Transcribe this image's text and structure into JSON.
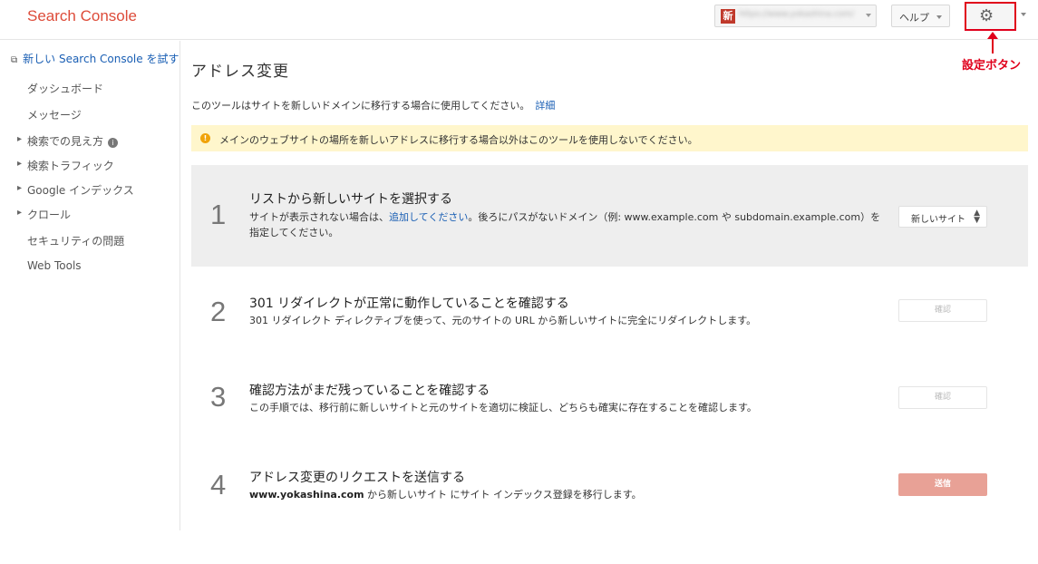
{
  "header": {
    "brand": "Search Console",
    "site_badge": "新",
    "site_url": "https://www.yokashina.com/",
    "help_label": "ヘルプ",
    "settings_icon": "gear-icon",
    "annotation": "設定ボタン",
    "accent": "#e0001b"
  },
  "sidebar": {
    "try_new": "新しい Search Console を試す",
    "items": [
      {
        "label": "ダッシュボード",
        "expandable": false
      },
      {
        "label": "メッセージ",
        "expandable": false
      },
      {
        "label": "検索での見え方",
        "expandable": true,
        "info": "i"
      },
      {
        "label": "検索トラフィック",
        "expandable": true
      },
      {
        "label": "Google インデックス",
        "expandable": true
      },
      {
        "label": "クロール",
        "expandable": true
      },
      {
        "label": "セキュリティの問題",
        "expandable": false
      },
      {
        "label": "Web Tools",
        "expandable": false
      }
    ]
  },
  "main": {
    "title": "アドレス変更",
    "intro": "このツールはサイトを新しいドメインに移行する場合に使用してください。",
    "intro_link": "詳細",
    "warning": "メインのウェブサイトの場所を新しいアドレスに移行する場合以外はこのツールを使用しないでください。",
    "steps": [
      {
        "number": "1",
        "title": "リストから新しいサイトを選択する",
        "desc_a": "サイトが表示されない場合は、",
        "desc_link": "追加してください",
        "desc_b": "。後ろにパスがないドメイン（例: www.example.com や subdomain.example.com）を",
        "desc_c": "指定してください。",
        "select_label": "新しいサイト"
      },
      {
        "number": "2",
        "title": "301 リダイレクトが正常に動作していることを確認する",
        "desc": "301 リダイレクト ディレクティブを使って、元のサイトの URL から新しいサイトに完全にリダイレクトします。",
        "button": "確認"
      },
      {
        "number": "3",
        "title": "確認方法がまだ残っていることを確認する",
        "desc": "この手順では、移行前に新しいサイトと元のサイトを適切に検証し、どちらも確実に存在することを確認します。",
        "button": "確認"
      },
      {
        "number": "4",
        "title": "アドレス変更のリクエストを送信する",
        "desc_bold": "www.yokashina.com",
        "desc": " から新しいサイト にサイト インデックス登録を移行します。",
        "button": "送信"
      }
    ]
  }
}
